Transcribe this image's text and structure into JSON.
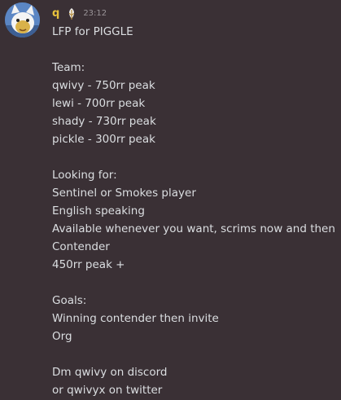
{
  "message": {
    "username": "q",
    "timestamp": "23:12",
    "avatar_icon": "cat-avatar-icon",
    "role_icon": "leaf-badge-icon",
    "username_color": "#e7c13c",
    "lines": [
      "LFP for PIGGLE",
      "",
      "Team:",
      "qwivy - 750rr peak",
      "lewi - 700rr peak",
      "shady - 730rr peak",
      "pickle - 300rr peak",
      "",
      "Looking for:",
      "Sentinel or Smokes player",
      "English speaking",
      "Available whenever you want, scrims now and then",
      "Contender",
      "450rr peak +",
      "",
      "Goals:",
      "Winning contender then invite",
      "Org",
      "",
      "Dm qwivy on discord",
      "or qwivyx on twitter"
    ]
  }
}
